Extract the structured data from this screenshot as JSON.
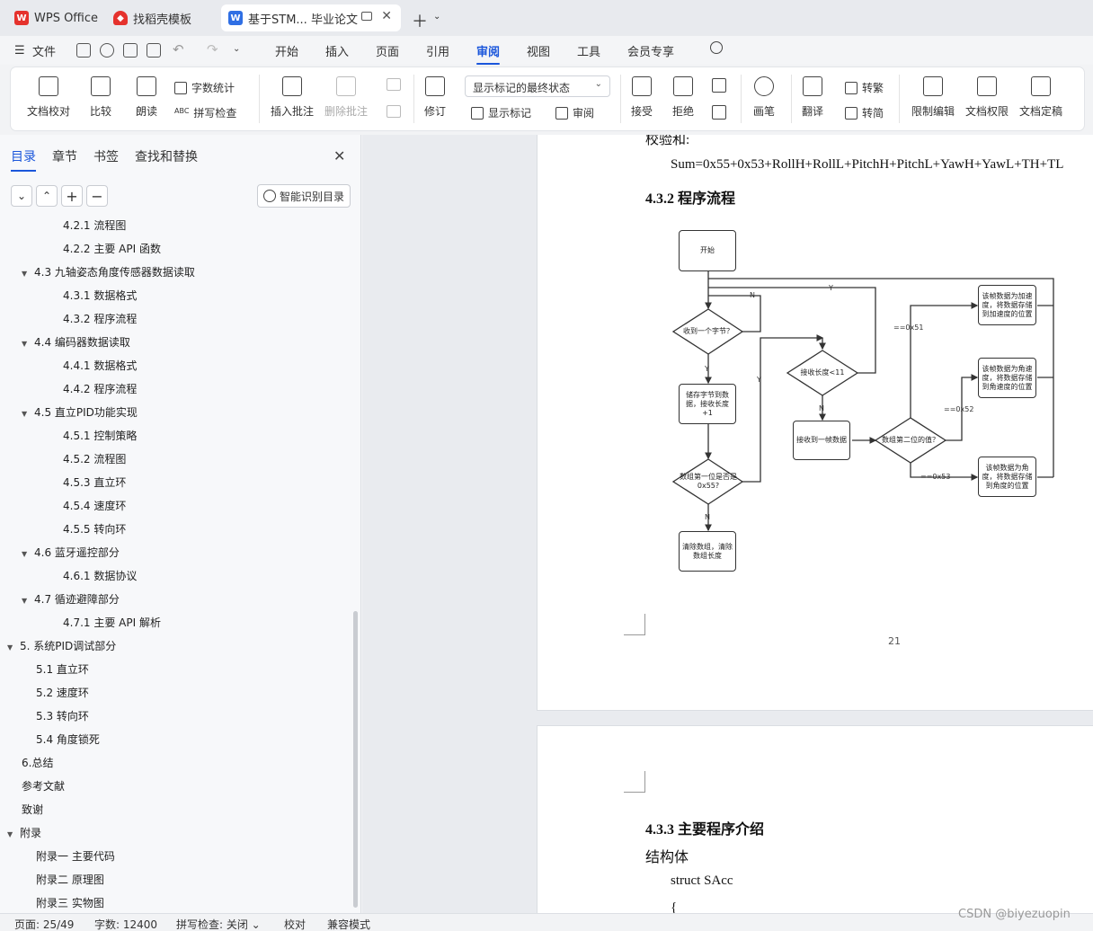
{
  "tabs": [
    {
      "label": "WPS Office",
      "icon": "wps-logo-icon"
    },
    {
      "label": "找稻壳模板",
      "icon": "docer-logo-icon"
    },
    {
      "label": "基于STM... 毕业论文",
      "icon": "word-doc-icon"
    }
  ],
  "menu": {
    "file": "文件",
    "items": [
      "开始",
      "插入",
      "页面",
      "引用",
      "审阅",
      "视图",
      "工具",
      "会员专享"
    ],
    "active": "审阅"
  },
  "ribbon": {
    "proofread": "文档校对",
    "compare": "比较",
    "read_aloud": "朗读",
    "word_count": "字数统计",
    "spell_check": "拼写检查",
    "insert_comment": "插入批注",
    "delete_comment": "删除批注",
    "revise": "修订",
    "markup_state": "显示标记的最终状态",
    "show_markup": "显示标记",
    "review": "审阅",
    "accept": "接受",
    "reject": "拒绝",
    "pen": "画笔",
    "translate": "翻译",
    "to_traditional": "转繁",
    "to_simplified": "转简",
    "restrict_edit": "限制编辑",
    "doc_permission": "文档权限",
    "finalize": "文档定稿"
  },
  "leftpane": {
    "tabs": [
      "目录",
      "章节",
      "书签",
      "查找和替换"
    ],
    "active_tab": "目录",
    "smart_btn": "智能识别目录",
    "toc": [
      {
        "label": "4.2.1  流程图",
        "level": 3,
        "arrow": ""
      },
      {
        "label": "4.2.2  主要 API 函数",
        "level": 3,
        "arrow": ""
      },
      {
        "label": "4.3    九轴姿态角度传感器数据读取",
        "level": 2,
        "arrow": "▼"
      },
      {
        "label": "4.3.1  数据格式",
        "level": 3,
        "arrow": ""
      },
      {
        "label": "4.3.2  程序流程",
        "level": 3,
        "arrow": ""
      },
      {
        "label": "4.4  编码器数据读取",
        "level": 2,
        "arrow": "▼"
      },
      {
        "label": "4.4.1  数据格式",
        "level": 3,
        "arrow": ""
      },
      {
        "label": "4.4.2  程序流程",
        "level": 3,
        "arrow": ""
      },
      {
        "label": "4.5  直立PID功能实现",
        "level": 2,
        "arrow": "▼"
      },
      {
        "label": "4.5.1  控制策略",
        "level": 3,
        "arrow": ""
      },
      {
        "label": "4.5.2  流程图",
        "level": 3,
        "arrow": ""
      },
      {
        "label": "4.5.3  直立环",
        "level": 3,
        "arrow": ""
      },
      {
        "label": "4.5.4  速度环",
        "level": 3,
        "arrow": ""
      },
      {
        "label": "4.5.5  转向环",
        "level": 3,
        "arrow": ""
      },
      {
        "label": "4.6  蓝牙遥控部分",
        "level": 2,
        "arrow": "▼"
      },
      {
        "label": "4.6.1  数据协议",
        "level": 3,
        "arrow": ""
      },
      {
        "label": "4.7  循迹避障部分",
        "level": 2,
        "arrow": "▼"
      },
      {
        "label": "4.7.1  主要 API 解析",
        "level": 3,
        "arrow": ""
      },
      {
        "label": "5.  系统PID调试部分",
        "level": 1,
        "arrow": "▼"
      },
      {
        "label": "5.1  直立环",
        "level": 2,
        "arrow": ""
      },
      {
        "label": "5.2  速度环",
        "level": 2,
        "arrow": ""
      },
      {
        "label": "5.3  转向环",
        "level": 2,
        "arrow": ""
      },
      {
        "label": "5.4  角度锁死",
        "level": 2,
        "arrow": ""
      },
      {
        "label": "6.总结",
        "level": 1,
        "arrow": ""
      },
      {
        "label": "参考文献",
        "level": 1,
        "arrow": ""
      },
      {
        "label": "致谢",
        "level": 1,
        "arrow": ""
      },
      {
        "label": "附录",
        "level": 1,
        "arrow": "▼"
      },
      {
        "label": "附录一  主要代码",
        "level": 2,
        "arrow": ""
      },
      {
        "label": "附录二  原理图",
        "level": 2,
        "arrow": ""
      },
      {
        "label": "附录三  实物图",
        "level": 2,
        "arrow": ""
      }
    ]
  },
  "doc": {
    "checksum_label": "校验和:",
    "checksum_formula": "Sum=0x55+0x53+RollH+RollL+PitchH+PitchL+YawH+YawL+TH+TL",
    "heading_432": "4.3.2  程序流程",
    "page_number": "21",
    "heading_433": "4.3.3  主要程序介绍",
    "struct_label": "结构体",
    "struct_code": "struct SAcc",
    "brace": "{"
  },
  "flowchart": {
    "start": "开始",
    "recv_byte": "收到一个字节？",
    "store": "储存字节到数据，接收长度+1",
    "first_is_55": "数组第一位是否是0x55?",
    "clear": "清除数组，清除数组长度",
    "len_lt_11": "接收长度<11",
    "got_frame": "接收到一帧数据",
    "second_val": "数组第二位的值？",
    "accel": "该帧数据为加速度，将数据存储到加速度的位置",
    "gyro": "该帧数据为角速度，将数据存储到角速度的位置",
    "angle": "该帧数据为角度，将数据存储到角度的位置",
    "y": "Y",
    "n": "N",
    "eq51": "==0x51",
    "eq52": "==0x52",
    "eq53": "==0x53"
  },
  "status": {
    "page": "页面: 25/49",
    "words": "字数: 12400",
    "spell": "拼写检查: 关闭",
    "proof": "校对",
    "compat": "兼容模式"
  },
  "watermark": "CSDN @biyezuopin",
  "colors": {
    "accent": "#1a56db",
    "wps_red": "#e5322d",
    "word_blue": "#2f6fe4"
  }
}
